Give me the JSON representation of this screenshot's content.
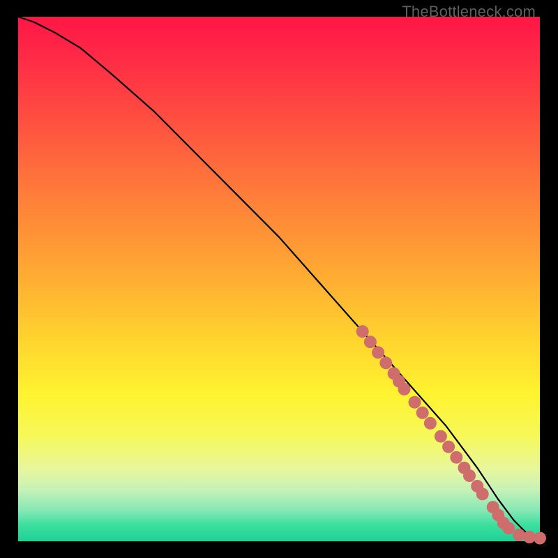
{
  "watermark": "TheBottleneck.com",
  "colors": {
    "background_black": "#000000",
    "gradient_top": "#ff1646",
    "gradient_mid": "#ffd52e",
    "gradient_bottom": "#1fd096",
    "curve": "#000000",
    "dot_fill": "#cf6d6d"
  },
  "chart_data": {
    "type": "line",
    "title": "",
    "xlabel": "",
    "ylabel": "",
    "xlim": [
      0,
      100
    ],
    "ylim": [
      0,
      100
    ],
    "series": [
      {
        "name": "bottleneck-curve",
        "x": [
          0,
          3,
          7,
          12,
          18,
          26,
          34,
          42,
          50,
          58,
          66,
          74,
          82,
          88,
          92,
          95,
          98,
          100
        ],
        "y": [
          100,
          99,
          97,
          94,
          89,
          82,
          74,
          66,
          58,
          49,
          40,
          31,
          22,
          14,
          8,
          4,
          1,
          0.5
        ]
      }
    ],
    "markers": [
      {
        "x": 66,
        "y": 40
      },
      {
        "x": 67.5,
        "y": 38
      },
      {
        "x": 69,
        "y": 36
      },
      {
        "x": 70.5,
        "y": 34
      },
      {
        "x": 72,
        "y": 32
      },
      {
        "x": 73,
        "y": 30.5
      },
      {
        "x": 74,
        "y": 29
      },
      {
        "x": 76,
        "y": 26.5
      },
      {
        "x": 77.5,
        "y": 24.5
      },
      {
        "x": 79,
        "y": 22.5
      },
      {
        "x": 81,
        "y": 20
      },
      {
        "x": 82.5,
        "y": 18
      },
      {
        "x": 84,
        "y": 16
      },
      {
        "x": 85.5,
        "y": 14
      },
      {
        "x": 86.5,
        "y": 12.5
      },
      {
        "x": 88,
        "y": 10.5
      },
      {
        "x": 89,
        "y": 9
      },
      {
        "x": 91,
        "y": 6.5
      },
      {
        "x": 92,
        "y": 5
      },
      {
        "x": 93,
        "y": 3.5
      },
      {
        "x": 94,
        "y": 2.5
      },
      {
        "x": 96,
        "y": 1.2
      },
      {
        "x": 98,
        "y": 0.8
      },
      {
        "x": 100,
        "y": 0.6
      }
    ]
  }
}
